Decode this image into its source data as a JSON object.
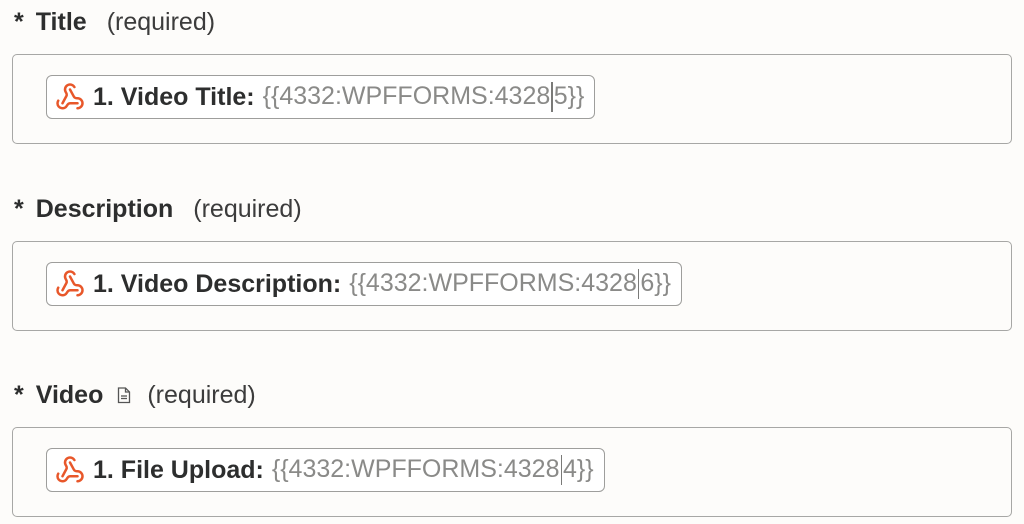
{
  "fields": [
    {
      "label": "Title",
      "required_text": "(required)",
      "pill": {
        "label": "1. Video Title:",
        "token_before_caret": "{{4332:WPFFORMS:4328",
        "token_after_caret": "5}}"
      }
    },
    {
      "label": "Description",
      "required_text": "(required)",
      "pill": {
        "label": "1. Video Description:",
        "token_before_caret": "{{4332:WPFFORMS:4328",
        "token_after_caret": "6}}"
      }
    },
    {
      "label": "Video",
      "required_text": "(required)",
      "label_icon": "document-icon",
      "pill": {
        "label": "1. File Upload:",
        "token_before_caret": "{{4332:WPFFORMS:4328",
        "token_after_caret": "4}}"
      }
    }
  ],
  "asterisk": "*",
  "pill_icon": "webhook-icon",
  "colors": {
    "webhook_icon": "#e8572a",
    "background": "#fdfcfa",
    "border": "#a7a7a5",
    "token_text": "#8a8a88"
  }
}
